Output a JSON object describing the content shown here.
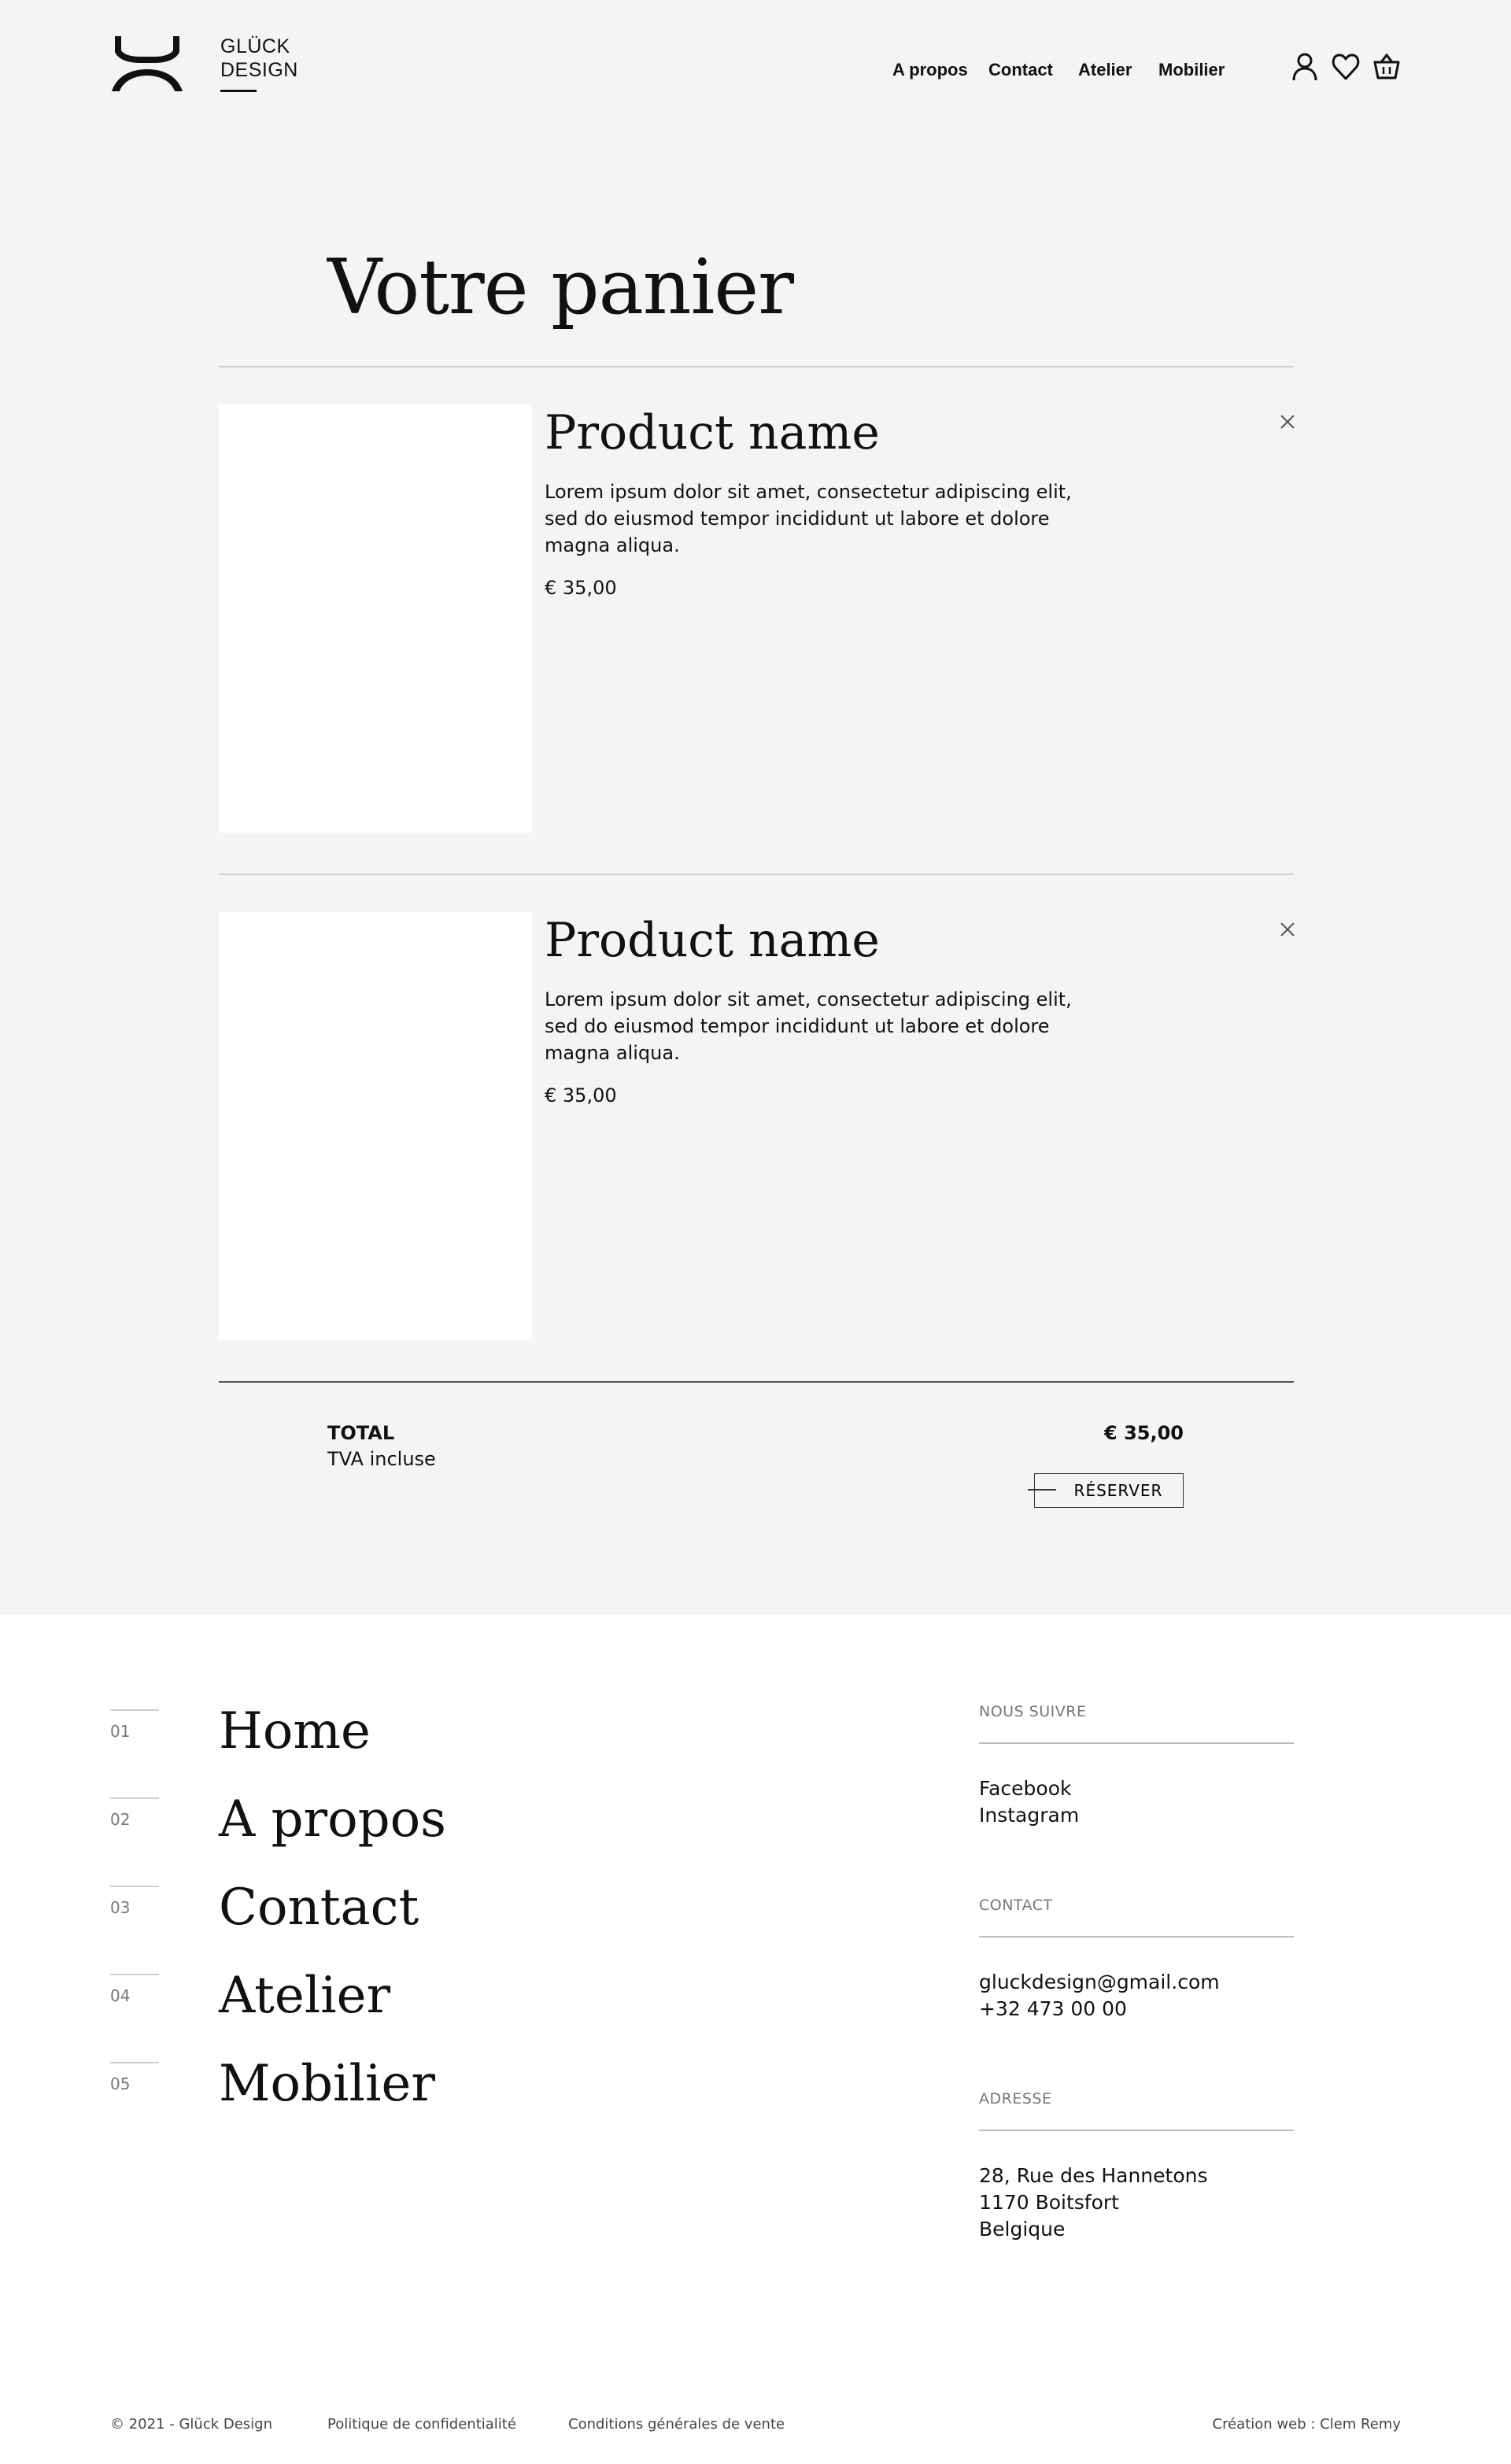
{
  "brand": {
    "line1": "GLÜCK",
    "line2": "DESIGN"
  },
  "nav": {
    "items": [
      {
        "label": "A propos"
      },
      {
        "label": "Contact"
      },
      {
        "label": "Atelier"
      },
      {
        "label": "Mobilier"
      }
    ],
    "icons": [
      "user-icon",
      "heart-icon",
      "basket-icon"
    ]
  },
  "page": {
    "title": "Votre panier"
  },
  "cart": {
    "items": [
      {
        "name": "Product name",
        "description": "Lorem ipsum dolor sit amet, consectetur adipiscing elit, sed do eiusmod tempor incididunt ut labore et dolore magna aliqua.",
        "price": "€ 35,00"
      },
      {
        "name": "Product name",
        "description": "Lorem ipsum dolor sit amet, consectetur adipiscing elit, sed do eiusmod tempor incididunt ut labore et dolore magna aliqua.",
        "price": "€ 35,00"
      }
    ],
    "total_label": "TOTAL",
    "total_sub": "TVA incluse",
    "total_value": "€ 35,00",
    "reserve_label": "RÉSERVER"
  },
  "footer": {
    "nav": [
      {
        "num": "01",
        "label": "Home"
      },
      {
        "num": "02",
        "label": "A propos"
      },
      {
        "num": "03",
        "label": "Contact"
      },
      {
        "num": "04",
        "label": "Atelier"
      },
      {
        "num": "05",
        "label": "Mobilier"
      }
    ],
    "follow": {
      "heading": "NOUS SUIVRE",
      "links": [
        "Facebook",
        "Instagram"
      ]
    },
    "contact": {
      "heading": "CONTACT",
      "email": "gluckdesign@gmail.com",
      "phone": "+32 473 00 00"
    },
    "address": {
      "heading": "ADRESSE",
      "lines": [
        "28, Rue des Hannetons",
        "1170 Boitsfort",
        "Belgique"
      ]
    },
    "legal": {
      "copyright": "© 2021 - Glück Design",
      "privacy": "Politique de confidentialité",
      "terms": "Conditions générales de vente",
      "credit": "Création web : Clem Remy"
    }
  },
  "colors": {
    "background_grey": "#f4f4f4",
    "text": "#111111",
    "rule": "#cfcfcf"
  }
}
